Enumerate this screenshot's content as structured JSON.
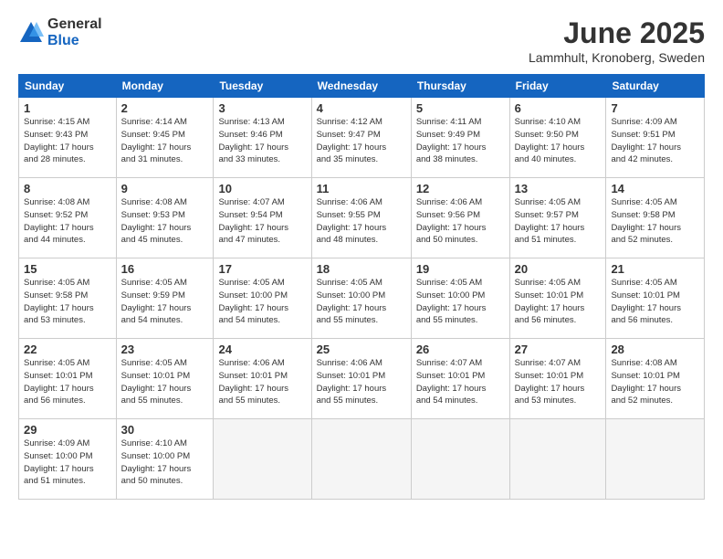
{
  "logo": {
    "general": "General",
    "blue": "Blue"
  },
  "title": "June 2025",
  "location": "Lammhult, Kronoberg, Sweden",
  "weekdays": [
    "Sunday",
    "Monday",
    "Tuesday",
    "Wednesday",
    "Thursday",
    "Friday",
    "Saturday"
  ],
  "weeks": [
    [
      {
        "day": "1",
        "info": "Sunrise: 4:15 AM\nSunset: 9:43 PM\nDaylight: 17 hours\nand 28 minutes."
      },
      {
        "day": "2",
        "info": "Sunrise: 4:14 AM\nSunset: 9:45 PM\nDaylight: 17 hours\nand 31 minutes."
      },
      {
        "day": "3",
        "info": "Sunrise: 4:13 AM\nSunset: 9:46 PM\nDaylight: 17 hours\nand 33 minutes."
      },
      {
        "day": "4",
        "info": "Sunrise: 4:12 AM\nSunset: 9:47 PM\nDaylight: 17 hours\nand 35 minutes."
      },
      {
        "day": "5",
        "info": "Sunrise: 4:11 AM\nSunset: 9:49 PM\nDaylight: 17 hours\nand 38 minutes."
      },
      {
        "day": "6",
        "info": "Sunrise: 4:10 AM\nSunset: 9:50 PM\nDaylight: 17 hours\nand 40 minutes."
      },
      {
        "day": "7",
        "info": "Sunrise: 4:09 AM\nSunset: 9:51 PM\nDaylight: 17 hours\nand 42 minutes."
      }
    ],
    [
      {
        "day": "8",
        "info": "Sunrise: 4:08 AM\nSunset: 9:52 PM\nDaylight: 17 hours\nand 44 minutes."
      },
      {
        "day": "9",
        "info": "Sunrise: 4:08 AM\nSunset: 9:53 PM\nDaylight: 17 hours\nand 45 minutes."
      },
      {
        "day": "10",
        "info": "Sunrise: 4:07 AM\nSunset: 9:54 PM\nDaylight: 17 hours\nand 47 minutes."
      },
      {
        "day": "11",
        "info": "Sunrise: 4:06 AM\nSunset: 9:55 PM\nDaylight: 17 hours\nand 48 minutes."
      },
      {
        "day": "12",
        "info": "Sunrise: 4:06 AM\nSunset: 9:56 PM\nDaylight: 17 hours\nand 50 minutes."
      },
      {
        "day": "13",
        "info": "Sunrise: 4:05 AM\nSunset: 9:57 PM\nDaylight: 17 hours\nand 51 minutes."
      },
      {
        "day": "14",
        "info": "Sunrise: 4:05 AM\nSunset: 9:58 PM\nDaylight: 17 hours\nand 52 minutes."
      }
    ],
    [
      {
        "day": "15",
        "info": "Sunrise: 4:05 AM\nSunset: 9:58 PM\nDaylight: 17 hours\nand 53 minutes."
      },
      {
        "day": "16",
        "info": "Sunrise: 4:05 AM\nSunset: 9:59 PM\nDaylight: 17 hours\nand 54 minutes."
      },
      {
        "day": "17",
        "info": "Sunrise: 4:05 AM\nSunset: 10:00 PM\nDaylight: 17 hours\nand 54 minutes."
      },
      {
        "day": "18",
        "info": "Sunrise: 4:05 AM\nSunset: 10:00 PM\nDaylight: 17 hours\nand 55 minutes."
      },
      {
        "day": "19",
        "info": "Sunrise: 4:05 AM\nSunset: 10:00 PM\nDaylight: 17 hours\nand 55 minutes."
      },
      {
        "day": "20",
        "info": "Sunrise: 4:05 AM\nSunset: 10:01 PM\nDaylight: 17 hours\nand 56 minutes."
      },
      {
        "day": "21",
        "info": "Sunrise: 4:05 AM\nSunset: 10:01 PM\nDaylight: 17 hours\nand 56 minutes."
      }
    ],
    [
      {
        "day": "22",
        "info": "Sunrise: 4:05 AM\nSunset: 10:01 PM\nDaylight: 17 hours\nand 56 minutes."
      },
      {
        "day": "23",
        "info": "Sunrise: 4:05 AM\nSunset: 10:01 PM\nDaylight: 17 hours\nand 55 minutes."
      },
      {
        "day": "24",
        "info": "Sunrise: 4:06 AM\nSunset: 10:01 PM\nDaylight: 17 hours\nand 55 minutes."
      },
      {
        "day": "25",
        "info": "Sunrise: 4:06 AM\nSunset: 10:01 PM\nDaylight: 17 hours\nand 55 minutes."
      },
      {
        "day": "26",
        "info": "Sunrise: 4:07 AM\nSunset: 10:01 PM\nDaylight: 17 hours\nand 54 minutes."
      },
      {
        "day": "27",
        "info": "Sunrise: 4:07 AM\nSunset: 10:01 PM\nDaylight: 17 hours\nand 53 minutes."
      },
      {
        "day": "28",
        "info": "Sunrise: 4:08 AM\nSunset: 10:01 PM\nDaylight: 17 hours\nand 52 minutes."
      }
    ],
    [
      {
        "day": "29",
        "info": "Sunrise: 4:09 AM\nSunset: 10:00 PM\nDaylight: 17 hours\nand 51 minutes."
      },
      {
        "day": "30",
        "info": "Sunrise: 4:10 AM\nSunset: 10:00 PM\nDaylight: 17 hours\nand 50 minutes."
      },
      {
        "day": "",
        "info": ""
      },
      {
        "day": "",
        "info": ""
      },
      {
        "day": "",
        "info": ""
      },
      {
        "day": "",
        "info": ""
      },
      {
        "day": "",
        "info": ""
      }
    ]
  ]
}
